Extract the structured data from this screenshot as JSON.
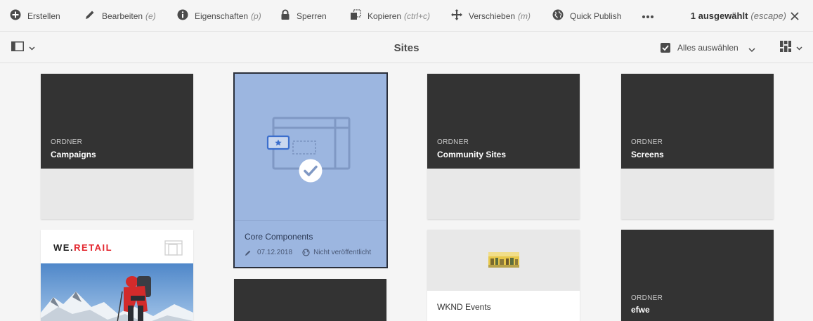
{
  "actionbar": {
    "actions": [
      {
        "label": "Erstellen",
        "shortcut": "",
        "icon": "plus-circle-icon"
      },
      {
        "label": "Bearbeiten",
        "shortcut": "(e)",
        "icon": "pencil-icon"
      },
      {
        "label": "Eigenschaften",
        "shortcut": "(p)",
        "icon": "info-icon"
      },
      {
        "label": "Sperren",
        "shortcut": "",
        "icon": "lock-icon"
      },
      {
        "label": "Kopieren",
        "shortcut": "(ctrl+c)",
        "icon": "copy-icon"
      },
      {
        "label": "Verschieben",
        "shortcut": "(m)",
        "icon": "move-icon"
      },
      {
        "label": "Quick Publish",
        "shortcut": "",
        "icon": "globe-icon"
      }
    ],
    "more_icon": "more-icon",
    "selection_count": "1 ausgewählt",
    "selection_shortcut": "(escape)",
    "close_icon": "close-icon"
  },
  "header": {
    "title": "Sites",
    "select_all_label": "Alles auswählen",
    "rail_icon": "rail-toggle-icon",
    "view_icon": "card-view-icon"
  },
  "cards": {
    "campaigns": {
      "kind": "ORDNER",
      "name": "Campaigns"
    },
    "core_components": {
      "name": "Core Components",
      "date": "07.12.2018",
      "status": "Nicht veröffentlicht"
    },
    "community_sites": {
      "kind": "ORDNER",
      "name": "Community Sites"
    },
    "screens": {
      "kind": "ORDNER",
      "name": "Screens"
    },
    "we_retail": {
      "logo_a": "WE.",
      "logo_b": "RETAIL"
    },
    "wknd_events": {
      "name": "WKND Events"
    },
    "efwe": {
      "kind": "ORDNER",
      "name": "efwe"
    }
  },
  "colors": {
    "selection_fill": "#9cb6e0",
    "folder_dark": "#333333",
    "accent_red": "#e3262e"
  }
}
